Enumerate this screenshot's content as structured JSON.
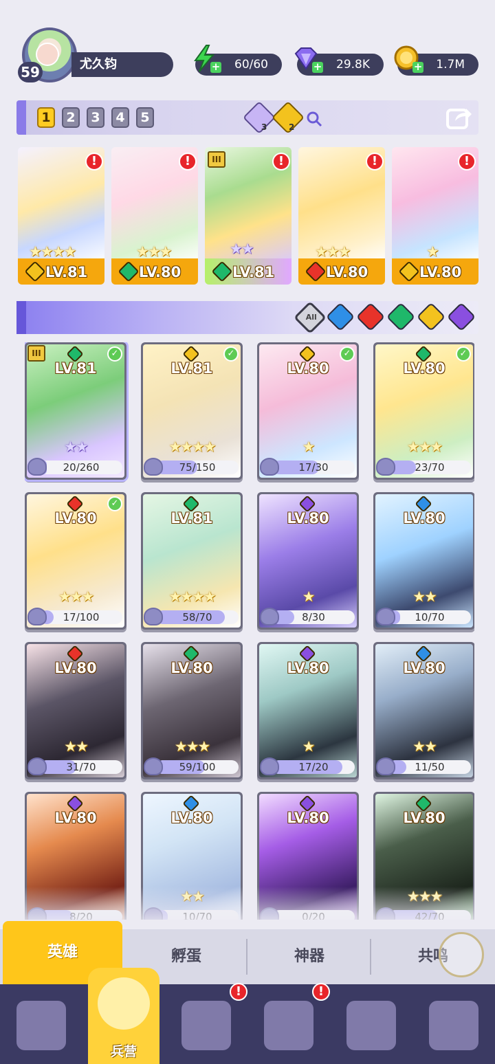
{
  "player": {
    "level": "59",
    "name": "尤久钧"
  },
  "resources": {
    "energy": {
      "value": "60/60",
      "icon": "lightning-icon",
      "color": "#3bd64f"
    },
    "gems": {
      "value": "29.8K",
      "icon": "diamond-icon",
      "color": "#8b6cf0"
    },
    "coins": {
      "value": "1.7M",
      "icon": "coin-icon",
      "color": "#f5c02a"
    }
  },
  "team_tabs": [
    "1",
    "2",
    "3",
    "4",
    "5"
  ],
  "active_team_tab": "1",
  "team_info": {
    "dark_count": "3",
    "light_count": "2"
  },
  "lineup": [
    {
      "level": "LV.81",
      "stars": "★★★★",
      "star_type": "gold",
      "element": "light",
      "alert": "!",
      "rank": ""
    },
    {
      "level": "LV.80",
      "stars": "★★★",
      "star_type": "gold",
      "element": "nature",
      "alert": "!",
      "rank": ""
    },
    {
      "level": "LV.81",
      "stars": "★★",
      "star_type": "purple",
      "element": "nature",
      "alert": "!",
      "rank": "III"
    },
    {
      "level": "LV.80",
      "stars": "★★★",
      "star_type": "gold",
      "element": "fire",
      "alert": "!",
      "rank": ""
    },
    {
      "level": "LV.80",
      "stars": "★",
      "star_type": "gold",
      "element": "light",
      "alert": "!",
      "rank": ""
    }
  ],
  "filters": [
    "All",
    "water",
    "fire",
    "nature",
    "light",
    "dark"
  ],
  "filter_all_label": "All",
  "elements": {
    "light": "#f3c21e",
    "nature": "#1fb86a",
    "fire": "#e8332a",
    "water": "#2f8fe6",
    "dark": "#8a4fe0"
  },
  "heroes": [
    {
      "level": "LV.81",
      "element": "nature",
      "stars": "★★",
      "star_type": "purple",
      "shards": "20/260",
      "progress": 0.08,
      "check": true,
      "rank": "III"
    },
    {
      "level": "LV.81",
      "element": "light",
      "stars": "★★★★",
      "star_type": "gold",
      "shards": "75/150",
      "progress": 0.5,
      "check": true,
      "rank": ""
    },
    {
      "level": "LV.80",
      "element": "light",
      "stars": "★",
      "star_type": "gold",
      "shards": "17/30",
      "progress": 0.57,
      "check": true,
      "rank": ""
    },
    {
      "level": "LV.80",
      "element": "nature",
      "stars": "★★★",
      "star_type": "gold",
      "shards": "23/70",
      "progress": 0.33,
      "check": true,
      "rank": ""
    },
    {
      "level": "LV.80",
      "element": "fire",
      "stars": "★★★",
      "star_type": "gold",
      "shards": "17/100",
      "progress": 0.17,
      "check": true,
      "rank": ""
    },
    {
      "level": "LV.81",
      "element": "nature",
      "stars": "★★★★",
      "star_type": "gold",
      "shards": "58/70",
      "progress": 0.83,
      "check": false,
      "rank": ""
    },
    {
      "level": "LV.80",
      "element": "dark",
      "stars": "★",
      "star_type": "gold",
      "shards": "8/30",
      "progress": 0.27,
      "check": false,
      "rank": ""
    },
    {
      "level": "LV.80",
      "element": "water",
      "stars": "★★",
      "star_type": "gold",
      "shards": "10/70",
      "progress": 0.14,
      "check": false,
      "rank": ""
    },
    {
      "level": "LV.80",
      "element": "fire",
      "stars": "★★",
      "star_type": "gold",
      "shards": "31/70",
      "progress": 0.44,
      "check": false,
      "rank": ""
    },
    {
      "level": "LV.80",
      "element": "nature",
      "stars": "★★★",
      "star_type": "gold",
      "shards": "59/100",
      "progress": 0.59,
      "check": false,
      "rank": ""
    },
    {
      "level": "LV.80",
      "element": "dark",
      "stars": "★",
      "star_type": "gold",
      "shards": "17/20",
      "progress": 0.85,
      "check": false,
      "rank": ""
    },
    {
      "level": "LV.80",
      "element": "water",
      "stars": "★★",
      "star_type": "gold",
      "shards": "11/50",
      "progress": 0.22,
      "check": false,
      "rank": ""
    },
    {
      "level": "LV.80",
      "element": "dark",
      "stars": "",
      "star_type": "gold",
      "shards": "8/20",
      "progress": 0.4,
      "check": false,
      "rank": ""
    },
    {
      "level": "LV.80",
      "element": "water",
      "stars": "★★",
      "star_type": "gold",
      "shards": "10/70",
      "progress": 0.14,
      "check": false,
      "rank": ""
    },
    {
      "level": "LV.80",
      "element": "dark",
      "stars": "",
      "star_type": "gold",
      "shards": "0/20",
      "progress": 0.0,
      "check": false,
      "rank": ""
    },
    {
      "level": "LV.80",
      "element": "nature",
      "stars": "★★★",
      "star_type": "gold",
      "shards": "42/70",
      "progress": 0.6,
      "check": false,
      "rank": ""
    }
  ],
  "sub_tabs": [
    "英雄",
    "孵蛋",
    "神器",
    "共鸣"
  ],
  "active_sub_tab": "英雄",
  "nav": [
    {
      "name": "cards-icon",
      "label": ""
    },
    {
      "name": "barracks-icon",
      "label": "兵营",
      "active": true
    },
    {
      "name": "map-icon",
      "label": "",
      "alert": "!"
    },
    {
      "name": "castle-icon",
      "label": "",
      "alert": "!"
    },
    {
      "name": "mushroom-icon",
      "label": ""
    },
    {
      "name": "guild-icon",
      "label": ""
    }
  ]
}
